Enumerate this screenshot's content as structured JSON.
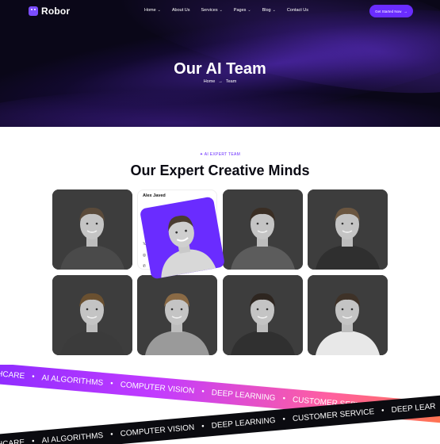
{
  "nav": {
    "brand": "Robor",
    "items": [
      {
        "label": "Home",
        "has_dropdown": true
      },
      {
        "label": "About Us",
        "has_dropdown": false
      },
      {
        "label": "Services",
        "has_dropdown": true
      },
      {
        "label": "Pages",
        "has_dropdown": true
      },
      {
        "label": "Blog",
        "has_dropdown": true
      },
      {
        "label": "Contact Us",
        "has_dropdown": false
      }
    ],
    "cta_label": "Get Started Now",
    "cta_arrow": "→"
  },
  "hero": {
    "title": "Our AI Team",
    "breadcrumb": [
      "Home",
      "→",
      "Team"
    ]
  },
  "section": {
    "eyebrow": "✦ AI EXPERT TEAM",
    "title": "Our Expert Creative Minds"
  },
  "featured": {
    "name": "Alex Javed",
    "social": [
      "f",
      "𝕏",
      "◎",
      "✆"
    ]
  },
  "team_photos": [
    {
      "hair": "#5a4a3a",
      "shirt": "#4a4a4a"
    },
    {
      "hair": "#3a2e24",
      "shirt": "#5c5c5c"
    },
    {
      "hair": "#6b5640",
      "shirt": "#2f2f2f"
    },
    {
      "hair": "#6a5030",
      "shirt": "#3b3b3b"
    },
    {
      "hair": "#8a6a45",
      "shirt": "#9a9a9a"
    },
    {
      "hair": "#2e2620",
      "shirt": "#303030"
    },
    {
      "hair": "#3e3228",
      "shirt": "#e8e8e8"
    }
  ],
  "banner_top": [
    "THCARE",
    "AI ALGORITHMS",
    "COMPUTER VISION",
    "DEEP LEARNING",
    "CUSTOMER SERVICE",
    "DEEP LEAR"
  ],
  "banner_bottom": [
    "THCARE",
    "AI ALGORITHMS",
    "COMPUTER VISION",
    "DEEP LEARNING",
    "CUSTOMER SERVICE",
    "DEEP LEAR"
  ],
  "colors": {
    "accent": "#6a2cff",
    "hero_bg": "#0a0718"
  }
}
